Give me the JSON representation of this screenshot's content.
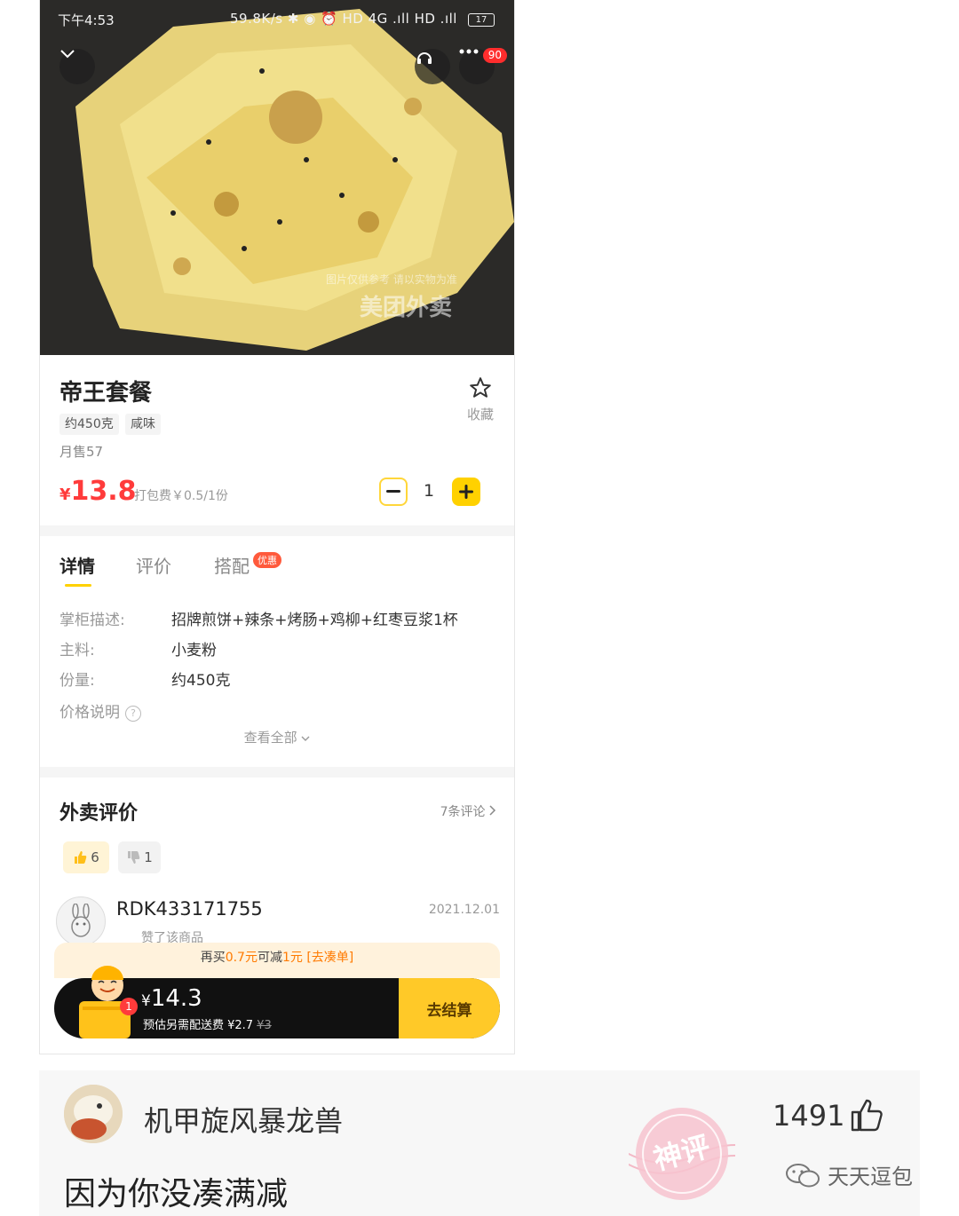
{
  "status_bar": {
    "time": "下午4:53",
    "right": "59.8K/s ✱ ◉ ⏰ HD 4G .ıll HD .ıll",
    "battery": "17"
  },
  "hero": {
    "badge": "90",
    "watermark_line1": "图片仅供参考 请以实物为准",
    "watermark_line2": "美团外卖"
  },
  "product": {
    "name": "帝王套餐",
    "favorite_label": "收藏",
    "tags": [
      "约450克",
      "咸味"
    ],
    "monthly_sales": "月售57",
    "price_symbol": "¥",
    "price": "13.8",
    "packing_fee": "打包费￥0.5/1份",
    "quantity": "1"
  },
  "tabs": {
    "details": "详情",
    "reviews": "评价",
    "combo": "搭配",
    "combo_badge": "优惠"
  },
  "details": {
    "rows": [
      {
        "label": "掌柜描述:",
        "value": "招牌煎饼+辣条+烤肠+鸡柳+红枣豆浆1杯"
      },
      {
        "label": "主料:",
        "value": "小麦粉"
      },
      {
        "label": "份量:",
        "value": "约450克"
      }
    ],
    "price_note": "价格说明",
    "help": "?",
    "view_all": "查看全部"
  },
  "reviews": {
    "title": "外卖评价",
    "count": "7条评论",
    "up_count": "6",
    "down_count": "1",
    "user": "RDK433171755",
    "date": "2021.12.01",
    "liked_text": "赞了该商品"
  },
  "cart": {
    "promo_prefix": "再买",
    "promo_amount": "0.7元",
    "promo_mid": "可减",
    "promo_discount": "1元",
    "promo_link": "[去凑单]",
    "item_count": "1",
    "total_symbol": "¥",
    "total": "14.3",
    "delivery_text": "预估另需配送费 ¥2.7",
    "delivery_original": "¥3",
    "checkout": "去结算"
  },
  "comment": {
    "username": "机甲旋风暴龙兽",
    "likes": "1491",
    "text": "因为你没凑满减",
    "stamp": "神评",
    "brand": "天天逗包"
  },
  "colors": {
    "accent_yellow": "#ffd100",
    "price_red": "#ff3b3b",
    "promo_orange": "#ff7a00"
  }
}
